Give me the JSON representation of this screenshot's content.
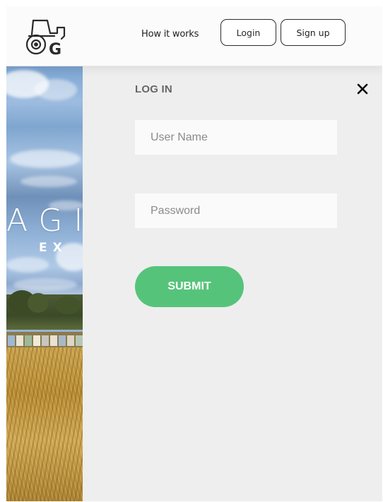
{
  "header": {
    "nav_link": "How it works",
    "login_label": "Login",
    "signup_label": "Sign up"
  },
  "hero": {
    "title_partial": "AGI",
    "subtitle_partial": "EX"
  },
  "login_panel": {
    "title": "LOG IN",
    "username_placeholder": "User Name",
    "password_placeholder": "Password",
    "submit_label": "SUBMIT"
  },
  "icons": {
    "logo": "tractor-logo-icon",
    "close": "close-icon"
  },
  "colors": {
    "accent": "#55c47a",
    "panel_bg": "#eeeeee",
    "input_bg": "#fafafa",
    "title_text": "#666666"
  }
}
